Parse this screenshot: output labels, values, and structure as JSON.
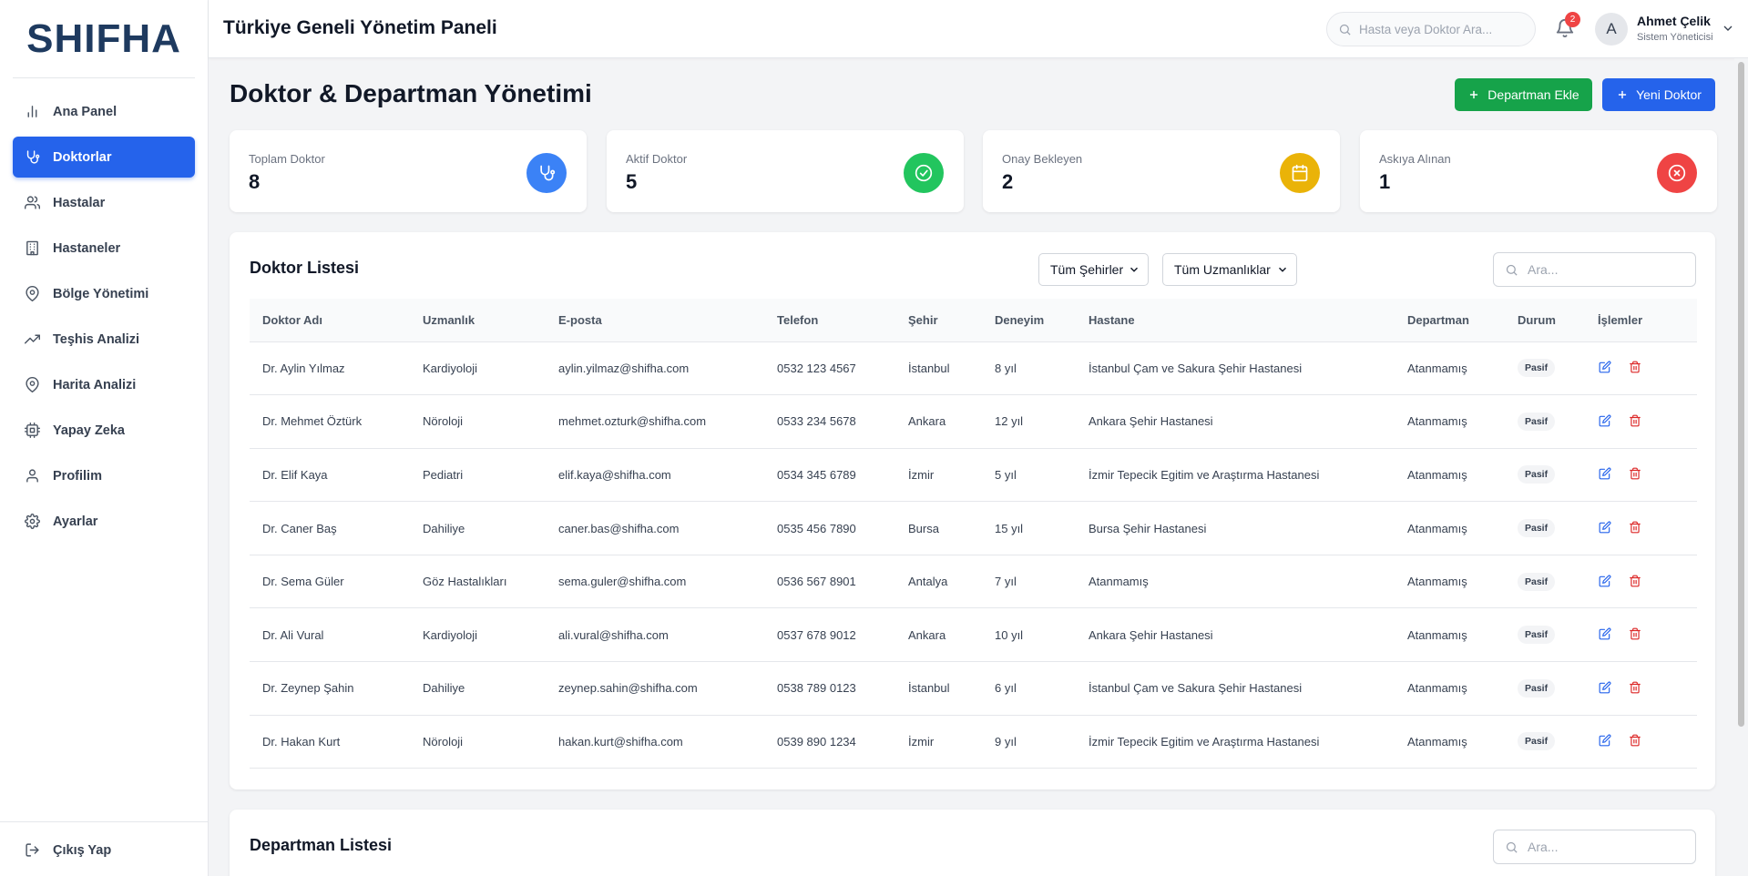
{
  "app": {
    "logo": "SHIFHA"
  },
  "sidebar": {
    "items": [
      {
        "label": "Ana Panel",
        "icon": "bar-chart-icon"
      },
      {
        "label": "Doktorlar",
        "icon": "stethoscope-icon",
        "active": true
      },
      {
        "label": "Hastalar",
        "icon": "users-icon"
      },
      {
        "label": "Hastaneler",
        "icon": "building-icon"
      },
      {
        "label": "Bölge Yönetimi",
        "icon": "map-pin-icon"
      },
      {
        "label": "Teşhis Analizi",
        "icon": "trending-up-icon"
      },
      {
        "label": "Harita Analizi",
        "icon": "map-pin-icon"
      },
      {
        "label": "Yapay Zeka",
        "icon": "cpu-icon"
      },
      {
        "label": "Profilim",
        "icon": "user-icon"
      },
      {
        "label": "Ayarlar",
        "icon": "gear-icon"
      }
    ],
    "logout_label": "Çıkış Yap"
  },
  "topbar": {
    "title": "Türkiye Geneli Yönetim Paneli",
    "search_placeholder": "Hasta veya Doktor Ara...",
    "notification_count": "2",
    "avatar_initial": "A",
    "user_name": "Ahmet Çelik",
    "user_role": "Sistem Yöneticisi"
  },
  "page": {
    "title": "Doktor & Departman Yönetimi",
    "add_department_label": "Departman Ekle",
    "new_doctor_label": "Yeni Doktor"
  },
  "stats": [
    {
      "label": "Toplam Doktor",
      "value": "8",
      "color": "#3b82f6",
      "icon": "stethoscope-icon"
    },
    {
      "label": "Aktif Doktor",
      "value": "5",
      "color": "#22c55e",
      "icon": "check-circle-icon"
    },
    {
      "label": "Onay Bekleyen",
      "value": "2",
      "color": "#eab308",
      "icon": "calendar-icon"
    },
    {
      "label": "Askıya Alınan",
      "value": "1",
      "color": "#ef4444",
      "icon": "x-circle-icon"
    }
  ],
  "doctor_list": {
    "title": "Doktor Listesi",
    "city_filter": "Tüm Şehirler",
    "specialty_filter": "Tüm Uzmanlıklar",
    "search_placeholder": "Ara...",
    "columns": [
      "Doktor Adı",
      "Uzmanlık",
      "E-posta",
      "Telefon",
      "Şehir",
      "Deneyim",
      "Hastane",
      "Departman",
      "Durum",
      "İşlemler"
    ],
    "rows": [
      [
        "Dr. Aylin Yılmaz",
        "Kardiyoloji",
        "aylin.yilmaz@shifha.com",
        "0532 123 4567",
        "İstanbul",
        "8 yıl",
        "İstanbul Çam ve Sakura Şehir Hastanesi",
        "Atanmamış",
        "Pasif"
      ],
      [
        "Dr. Mehmet Öztürk",
        "Nöroloji",
        "mehmet.ozturk@shifha.com",
        "0533 234 5678",
        "Ankara",
        "12 yıl",
        "Ankara Şehir Hastanesi",
        "Atanmamış",
        "Pasif"
      ],
      [
        "Dr. Elif Kaya",
        "Pediatri",
        "elif.kaya@shifha.com",
        "0534 345 6789",
        "İzmir",
        "5 yıl",
        "İzmir Tepecik Egitim ve Araştırma Hastanesi",
        "Atanmamış",
        "Pasif"
      ],
      [
        "Dr. Caner Baş",
        "Dahiliye",
        "caner.bas@shifha.com",
        "0535 456 7890",
        "Bursa",
        "15 yıl",
        "Bursa Şehir Hastanesi",
        "Atanmamış",
        "Pasif"
      ],
      [
        "Dr. Sema Güler",
        "Göz Hastalıkları",
        "sema.guler@shifha.com",
        "0536 567 8901",
        "Antalya",
        "7 yıl",
        "Atanmamış",
        "Atanmamış",
        "Pasif"
      ],
      [
        "Dr. Ali Vural",
        "Kardiyoloji",
        "ali.vural@shifha.com",
        "0537 678 9012",
        "Ankara",
        "10 yıl",
        "Ankara Şehir Hastanesi",
        "Atanmamış",
        "Pasif"
      ],
      [
        "Dr. Zeynep Şahin",
        "Dahiliye",
        "zeynep.sahin@shifha.com",
        "0538 789 0123",
        "İstanbul",
        "6 yıl",
        "İstanbul Çam ve Sakura Şehir Hastanesi",
        "Atanmamış",
        "Pasif"
      ],
      [
        "Dr. Hakan Kurt",
        "Nöroloji",
        "hakan.kurt@shifha.com",
        "0539 890 1234",
        "İzmir",
        "9 yıl",
        "İzmir Tepecik Egitim ve Araştırma Hastanesi",
        "Atanmamış",
        "Pasif"
      ]
    ]
  },
  "department_list": {
    "title": "Departman Listesi",
    "search_placeholder": "Ara..."
  }
}
